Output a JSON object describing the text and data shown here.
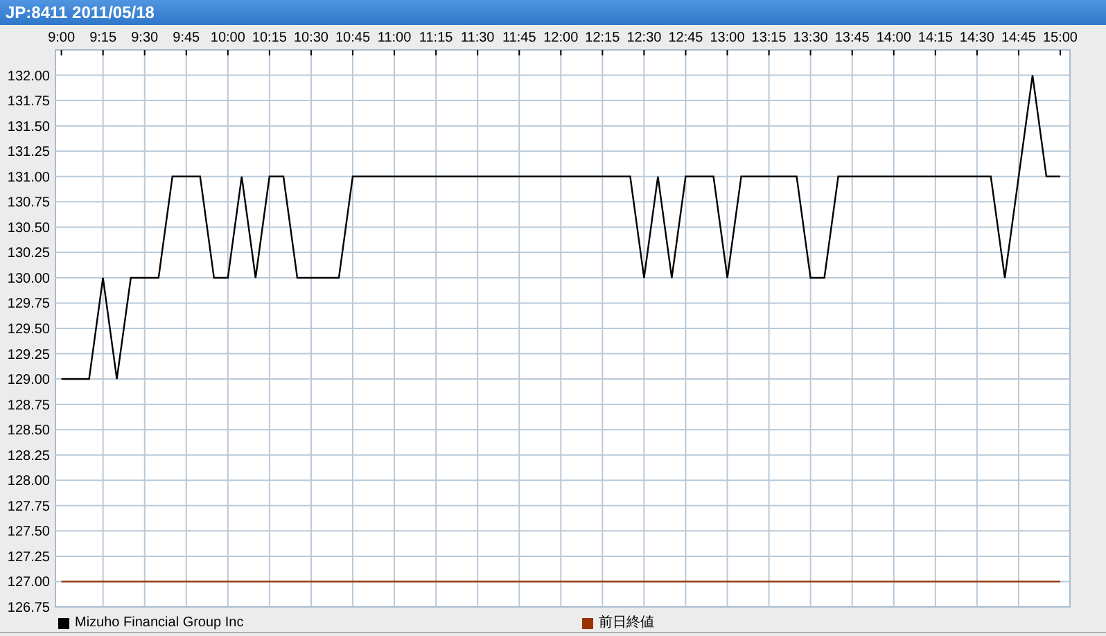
{
  "window": {
    "title": "JP:8411 2011/05/18"
  },
  "chart": {
    "chart_data": {
      "type": "line",
      "categories": [
        "9:00",
        null,
        null,
        "9:15",
        null,
        null,
        "9:30",
        null,
        null,
        "9:45",
        null,
        null,
        "10:00",
        null,
        null,
        "10:15",
        null,
        null,
        "10:30",
        null,
        null,
        "10:45",
        null,
        null,
        "11:00",
        null,
        null,
        "11:15",
        null,
        null,
        "11:30",
        null,
        null,
        "11:45",
        null,
        null,
        "12:00",
        null,
        null,
        "12:15",
        null,
        null,
        "12:30",
        null,
        null,
        "12:45",
        null,
        null,
        "13:00",
        null,
        null,
        "13:15",
        null,
        null,
        "13:30",
        null,
        null,
        "13:45",
        null,
        null,
        "14:00",
        null,
        null,
        "14:15",
        null,
        null,
        "14:30",
        null,
        null,
        "14:45",
        null,
        null,
        "15:00"
      ],
      "series": [
        {
          "name": "Mizuho Financial Group Inc",
          "color": "#000000",
          "values": [
            129,
            129,
            129,
            130,
            129,
            130,
            130,
            130,
            131,
            131,
            131,
            130,
            130,
            131,
            130,
            131,
            131,
            130,
            130,
            130,
            130,
            131,
            131,
            131,
            131,
            131,
            131,
            131,
            131,
            131,
            131,
            131,
            131,
            131,
            131,
            131,
            131,
            131,
            131,
            131,
            131,
            131,
            130,
            131,
            130,
            131,
            131,
            131,
            130,
            131,
            131,
            131,
            131,
            131,
            130,
            130,
            131,
            131,
            131,
            131,
            131,
            131,
            131,
            131,
            131,
            131,
            131,
            131,
            130,
            131,
            132,
            131,
            131
          ]
        },
        {
          "name": "前日終値",
          "color": "#993300",
          "values": [
            127,
            127,
            127,
            127,
            127,
            127,
            127,
            127,
            127,
            127,
            127,
            127,
            127,
            127,
            127,
            127,
            127,
            127,
            127,
            127,
            127,
            127,
            127,
            127,
            127,
            127,
            127,
            127,
            127,
            127,
            127,
            127,
            127,
            127,
            127,
            127,
            127,
            127,
            127,
            127,
            127,
            127,
            127,
            127,
            127,
            127,
            127,
            127,
            127,
            127,
            127,
            127,
            127,
            127,
            127,
            127,
            127,
            127,
            127,
            127,
            127,
            127,
            127,
            127,
            127,
            127,
            127,
            127,
            127,
            127,
            127,
            127,
            127
          ]
        }
      ],
      "grid": true,
      "ylim": [
        126.75,
        132.25
      ],
      "yticks": [
        {
          "value": 132,
          "label": "132.00"
        },
        {
          "value": 131.75,
          "label": "131.75"
        },
        {
          "value": 131.5,
          "label": "131.50"
        },
        {
          "value": 131.25,
          "label": "131.25"
        },
        {
          "value": 131,
          "label": "131.00"
        },
        {
          "value": 130.75,
          "label": "130.75"
        },
        {
          "value": 130.5,
          "label": "130.50"
        },
        {
          "value": 130.25,
          "label": "130.25"
        },
        {
          "value": 130,
          "label": "130.00"
        },
        {
          "value": 129.75,
          "label": "129.75"
        },
        {
          "value": 129.5,
          "label": "129.50"
        },
        {
          "value": 129.25,
          "label": "129.25"
        },
        {
          "value": 129,
          "label": "129.00"
        },
        {
          "value": 128.75,
          "label": "128.75"
        },
        {
          "value": 128.5,
          "label": "128.50"
        },
        {
          "value": 128.25,
          "label": "128.25"
        },
        {
          "value": 128,
          "label": "128.00"
        },
        {
          "value": 127.75,
          "label": "127.75"
        },
        {
          "value": 127.5,
          "label": "127.50"
        },
        {
          "value": 127.25,
          "label": "127.25"
        },
        {
          "value": 127,
          "label": "127.00"
        },
        {
          "value": 126.75,
          "label": "126.75"
        }
      ]
    }
  }
}
